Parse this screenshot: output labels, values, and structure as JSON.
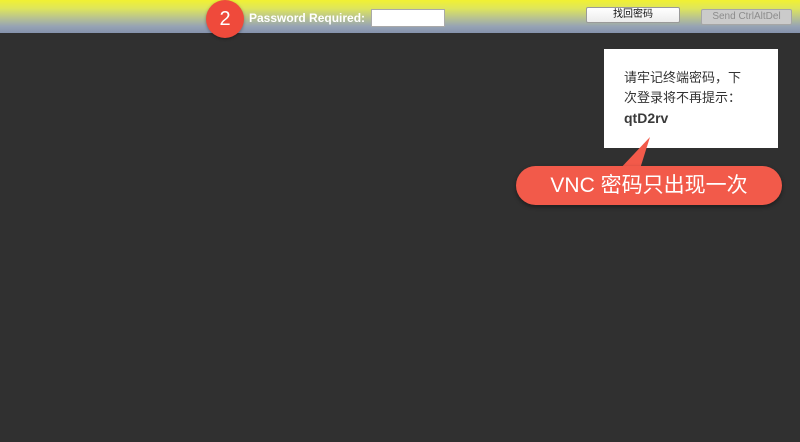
{
  "toolbar": {
    "badge_number": "2",
    "password_label": "Password Required:",
    "password_value": "",
    "recover_button_label": "找回密码",
    "send_cad_button_label": "Send CtrlAltDel"
  },
  "notice": {
    "line1": "请牢记终端密码，下",
    "line2": "次登录将不再提示：",
    "password": "qtD2rv"
  },
  "callout": {
    "text": "VNC 密码只出现一次"
  },
  "colors": {
    "topbar_top": "#f1f132",
    "topbar_bottom": "#8592ad",
    "screen_background": "#303030",
    "badge": "#ef4a3b",
    "callout": "#f25a4a",
    "notice_background": "#ffffff"
  }
}
